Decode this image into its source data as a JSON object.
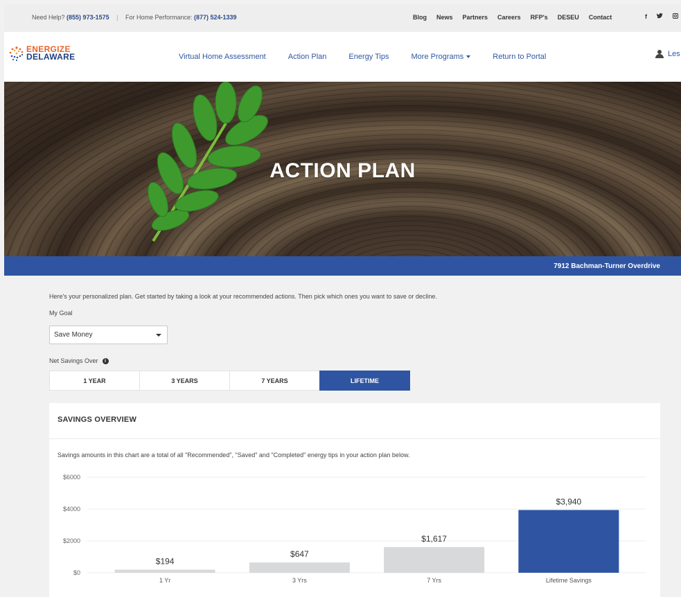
{
  "topbar": {
    "help_label": "Need Help?",
    "help_phone": "(855) 973-1575",
    "home_perf_label": "For Home Performance:",
    "home_perf_phone": "(877) 524-1339",
    "links": [
      "Blog",
      "News",
      "Partners",
      "Careers",
      "RFP's",
      "DESEU",
      "Contact"
    ],
    "social": [
      {
        "icon": "facebook-icon",
        "glyph": "f"
      },
      {
        "icon": "twitter-icon",
        "glyph": "♥"
      },
      {
        "icon": "instagram-icon",
        "glyph": "▣"
      }
    ]
  },
  "brand": {
    "line1": "ENERGIZE",
    "line2": "DELAWARE"
  },
  "nav": {
    "items": [
      "Virtual Home Assessment",
      "Action Plan",
      "Energy Tips",
      "More Programs",
      "Return to Portal"
    ],
    "user_label": "Les"
  },
  "hero": {
    "title": "ACTION PLAN"
  },
  "address": "7912 Bachman-Turner Overdrive",
  "intro": "Here's your personalized plan. Get started by taking a look at your recommended actions. Then pick which ones you want to save or decline.",
  "goal": {
    "label": "My Goal",
    "value": "Save Money"
  },
  "savings_over": {
    "label": "Net Savings Over",
    "tabs": [
      "1 YEAR",
      "3 YEARS",
      "7 YEARS",
      "LIFETIME"
    ],
    "active_index": 3
  },
  "overview": {
    "title": "SAVINGS OVERVIEW",
    "note": "Savings amounts in this chart are a total of all \"Recommended\", \"Saved\" and \"Completed\" energy tips in your action plan below."
  },
  "colors": {
    "accent": "#2f55a2",
    "bar_default": "#d7d9db",
    "bar_active": "#2f55a2",
    "brand_orange": "#e8632b",
    "brand_navy": "#1f3f7f"
  },
  "chart_data": {
    "type": "bar",
    "categories": [
      "1 Yr",
      "3 Yrs",
      "7 Yrs",
      "Lifetime Savings"
    ],
    "values": [
      194,
      647,
      1617,
      3940
    ],
    "data_labels": [
      "$194",
      "$647",
      "$1,617",
      "$3,940"
    ],
    "ytick_labels": [
      "$0",
      "$2000",
      "$4000",
      "$6000"
    ],
    "yticks": [
      0,
      2000,
      4000,
      6000
    ],
    "ylim": [
      0,
      6000
    ],
    "highlight_index": 3,
    "grid": true
  }
}
